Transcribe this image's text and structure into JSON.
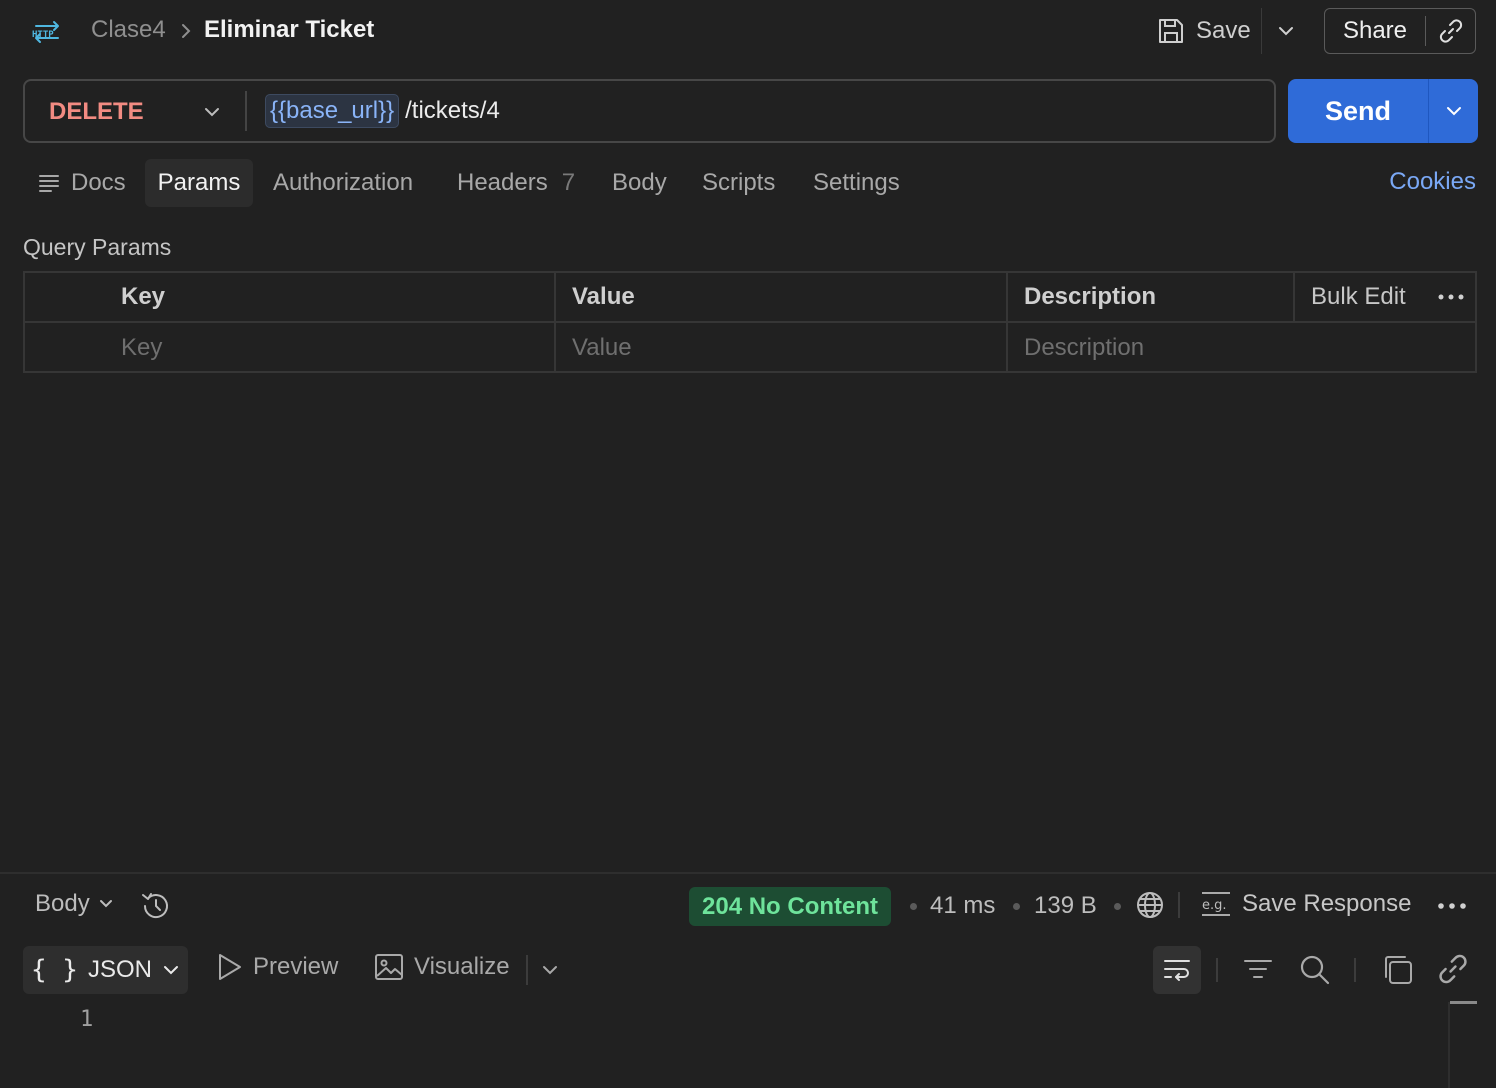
{
  "header": {
    "icon_label": "HTTP",
    "breadcrumb_parent": "Clase4",
    "title": "Eliminar Ticket",
    "save_label": "Save",
    "share_label": "Share"
  },
  "request": {
    "method": "DELETE",
    "url_variable": "{{base_url}}",
    "url_path": "/tickets/4",
    "send_label": "Send"
  },
  "tabs": {
    "docs": "Docs",
    "params": "Params",
    "authorization": "Authorization",
    "headers": "Headers",
    "headers_count": "7",
    "body": "Body",
    "scripts": "Scripts",
    "settings": "Settings",
    "active": "Params",
    "cookies": "Cookies"
  },
  "query_params": {
    "title": "Query Params",
    "columns": [
      "Key",
      "Value",
      "Description"
    ],
    "bulk_edit": "Bulk Edit",
    "placeholders": {
      "key": "Key",
      "value": "Value",
      "description": "Description"
    }
  },
  "response": {
    "body_select": "Body",
    "status": "204 No Content",
    "time": "41 ms",
    "size": "139 B",
    "save_response": "Save Response",
    "eg_label": "e.g.",
    "format": "JSON",
    "format_braces": "{ }",
    "preview": "Preview",
    "visualize": "Visualize",
    "line_numbers": [
      "1"
    ]
  },
  "colors": {
    "background": "#212121",
    "method": "#f28b82",
    "send": "#2f6bd8",
    "status_bg": "#1d4d33",
    "status_text": "#6ee39b",
    "link": "#7aa8f5",
    "url_variable": "#8ab4f8",
    "http_icon": "#4fb7e0"
  },
  "icons": [
    "http-icon",
    "chevron-right-icon",
    "save-icon",
    "chevron-down-icon",
    "link-icon",
    "docs-icon",
    "more-icon",
    "history-icon",
    "globe-icon",
    "example-icon",
    "play-icon",
    "image-icon",
    "wrap-icon",
    "filter-icon",
    "search-icon",
    "copy-icon"
  ]
}
